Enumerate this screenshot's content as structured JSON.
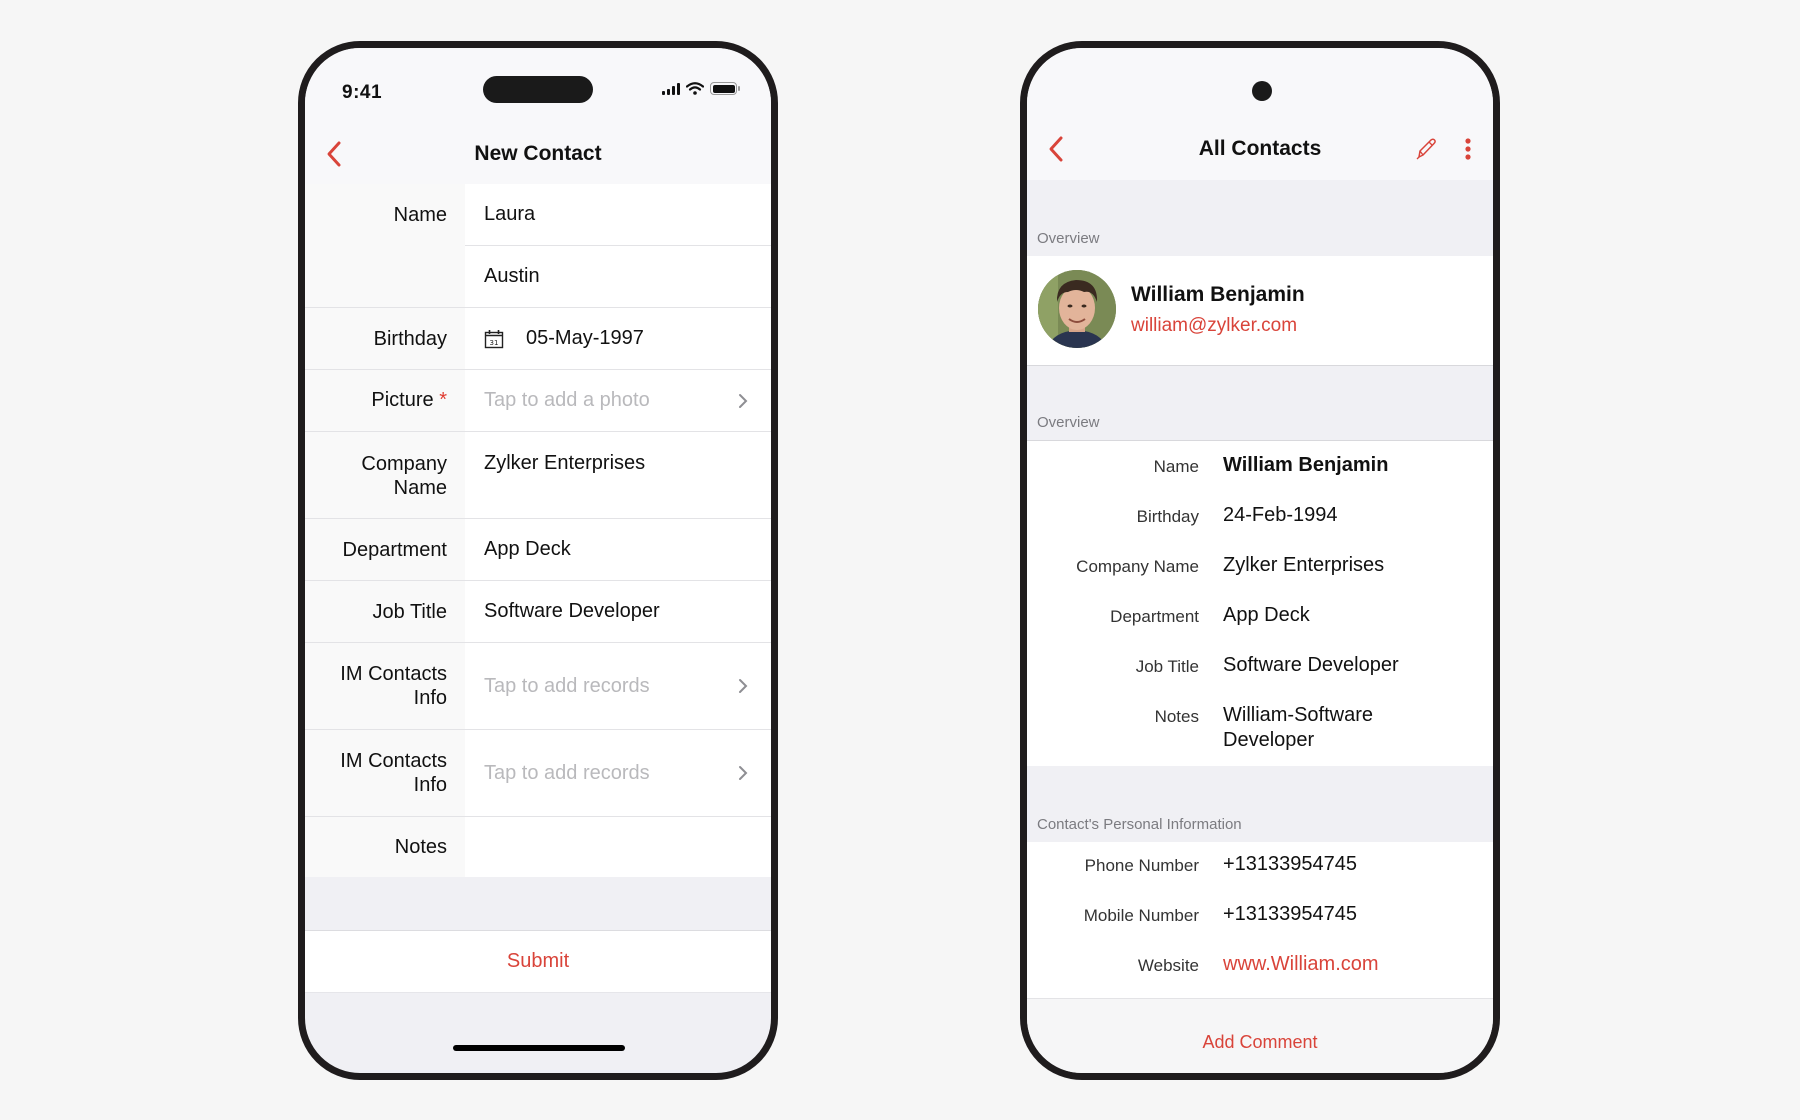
{
  "left_screen": {
    "status_bar": {
      "time": "9:41"
    },
    "header": {
      "title": "New Contact"
    },
    "form": {
      "name_label": "Name",
      "first_name": "Laura",
      "last_name": "Austin",
      "birthday_label": "Birthday",
      "birthday_value": "05-May-1997",
      "calendar_icon_day": "31",
      "picture_label": "Picture",
      "picture_required_marker": "*",
      "picture_placeholder": "Tap to add a photo",
      "company_label_line1": "Company",
      "company_label_line2": "Name",
      "company_value": "Zylker Enterprises",
      "department_label": "Department",
      "department_value": "App Deck",
      "job_title_label": "Job Title",
      "job_title_value": "Software Developer",
      "im_contacts_1_label_line1": "IM Contacts",
      "im_contacts_1_label_line2": "Info",
      "im_contacts_1_placeholder": "Tap to add records",
      "im_contacts_2_label_line1": "IM Contacts",
      "im_contacts_2_label_line2": "Info",
      "im_contacts_2_placeholder": "Tap to add records",
      "notes_label": "Notes",
      "notes_value": ""
    },
    "submit_label": "Submit"
  },
  "right_screen": {
    "header": {
      "title": "All Contacts"
    },
    "overview_section_1": "Overview",
    "profile": {
      "name": "William Benjamin",
      "email": "william@zylker.com"
    },
    "overview_section_2": "Overview",
    "details": [
      {
        "label": "Name",
        "value": "William Benjamin"
      },
      {
        "label": "Birthday",
        "value": "24-Feb-1994"
      },
      {
        "label": "Company Name",
        "value": "Zylker Enterprises"
      },
      {
        "label": "Department",
        "value": "App Deck"
      },
      {
        "label": "Job Title",
        "value": "Software Developer"
      },
      {
        "label": "Notes",
        "value": "William-Software Developer"
      }
    ],
    "personal_section": "Contact's Personal Information",
    "personal": [
      {
        "label": "Phone Number",
        "value": "+13133954745"
      },
      {
        "label": "Mobile Number",
        "value": "+13133954745"
      },
      {
        "label": "Website",
        "value": "www.William.com"
      }
    ],
    "add_comment_label": "Add Comment"
  },
  "colors": {
    "accent": "#d9443a",
    "phone_frame": "#1f1c1d",
    "section_bg": "#f0f0f4",
    "placeholder": "#b9b9bc"
  }
}
